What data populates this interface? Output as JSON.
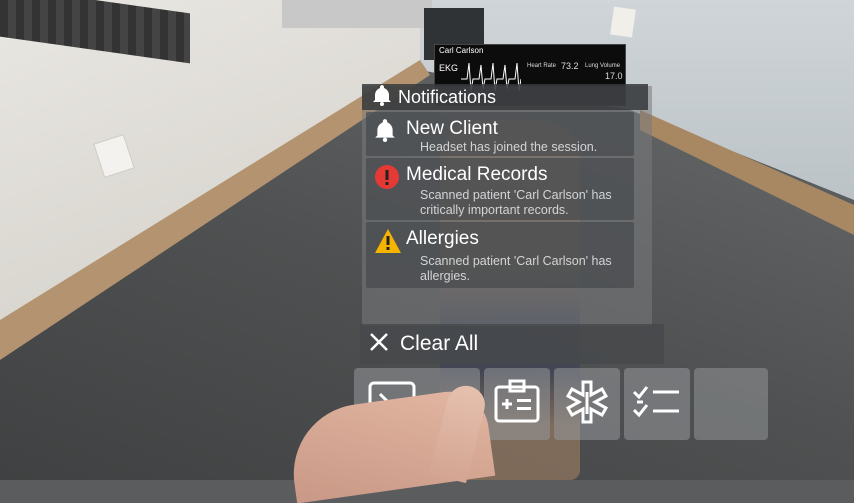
{
  "monitor": {
    "patient_name": "Carl Carlson",
    "ekg_label": "EKG",
    "stat1_label": "Heart Rate",
    "stat1_value": "73.2",
    "stat2_label": "Lung Volume",
    "stat2_value": "17.0"
  },
  "notifications": {
    "header": "Notifications",
    "items": [
      {
        "icon": "bell-icon",
        "title": "New Client",
        "body": "Headset has joined the session."
      },
      {
        "icon": "error-icon",
        "title": "Medical Records",
        "body": "Scanned patient 'Carl Carlson' has critically important records."
      },
      {
        "icon": "warning-icon",
        "title": "Allergies",
        "body": "Scanned patient 'Carl Carlson' has allergies."
      }
    ],
    "clear_label": "Clear All"
  },
  "toolbar": {
    "buttons": [
      {
        "icon": "terminal-icon"
      },
      {
        "icon": "patient-id-icon"
      },
      {
        "icon": "medical-star-icon"
      },
      {
        "icon": "checklist-icon"
      },
      {
        "icon": "empty-slot"
      }
    ]
  },
  "colors": {
    "error": "#e53935",
    "warning": "#f5b400",
    "panel": "#46484b"
  }
}
